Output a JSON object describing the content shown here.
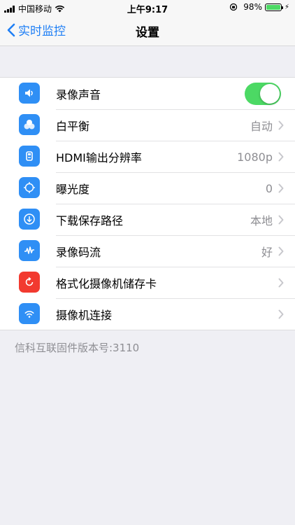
{
  "status_bar": {
    "carrier": "中国移动",
    "time": "上午9:17",
    "battery": "98%",
    "battery_level": 0.98
  },
  "nav": {
    "back_label": "实时监控",
    "title": "设置"
  },
  "settings": {
    "items": [
      {
        "label": "录像声音",
        "value": "",
        "icon": "speaker-icon",
        "control": "toggle",
        "toggle_on": true
      },
      {
        "label": "白平衡",
        "value": "自动",
        "icon": "color-circles-icon",
        "control": "chevron"
      },
      {
        "label": "HDMI输出分辨率",
        "value": "1080p",
        "icon": "hdmi-icon",
        "control": "chevron"
      },
      {
        "label": "曝光度",
        "value": "0",
        "icon": "exposure-icon",
        "control": "chevron"
      },
      {
        "label": "下载保存路径",
        "value": "本地",
        "icon": "download-icon",
        "control": "chevron"
      },
      {
        "label": "录像码流",
        "value": "好",
        "icon": "waveform-icon",
        "control": "chevron"
      },
      {
        "label": "格式化摄像机储存卡",
        "value": "",
        "icon": "refresh-icon",
        "control": "chevron"
      },
      {
        "label": "摄像机连接",
        "value": "",
        "icon": "wifi-icon",
        "control": "chevron"
      }
    ]
  },
  "footer": {
    "firmware": "信科互联固件版本号:3110"
  },
  "colors": {
    "accent": "#1f7ff5",
    "icon_blue": "#2f8ff5",
    "icon_red": "#f23a2f",
    "toggle_on": "#4cd964",
    "background": "#efeff4"
  }
}
